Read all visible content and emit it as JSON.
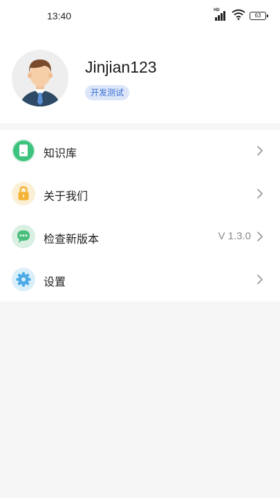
{
  "status_bar": {
    "time": "13:40",
    "network_label": "HD",
    "battery": "63",
    "icons": [
      "signal-icon",
      "wifi-icon",
      "battery-icon"
    ]
  },
  "profile": {
    "username": "Jinjian123",
    "tag": "开发测试",
    "avatar_icon": "avatar-man-icon"
  },
  "menu": {
    "items": [
      {
        "label": "知识库",
        "icon": "book-icon",
        "icon_color": "#3ec37e",
        "icon_bg": "#d8f1e4",
        "value": ""
      },
      {
        "label": "关于我们",
        "icon": "lock-icon",
        "icon_color": "#f5b335",
        "icon_bg": "#fbefd6",
        "value": ""
      },
      {
        "label": "检查新版本",
        "icon": "chat-bubble-icon",
        "icon_color": "#49bf7d",
        "icon_bg": "#daf0e3",
        "value": "V 1.3.0"
      },
      {
        "label": "设置",
        "icon": "gear-icon",
        "icon_color": "#4aa9e6",
        "icon_bg": "#dbeffa",
        "value": ""
      }
    ]
  },
  "colors": {
    "page_background": "#f6f6f6",
    "card_background": "#ffffff",
    "tag_background": "#dce6f8",
    "tag_text": "#3c6fd6",
    "chevron": "#999999"
  }
}
